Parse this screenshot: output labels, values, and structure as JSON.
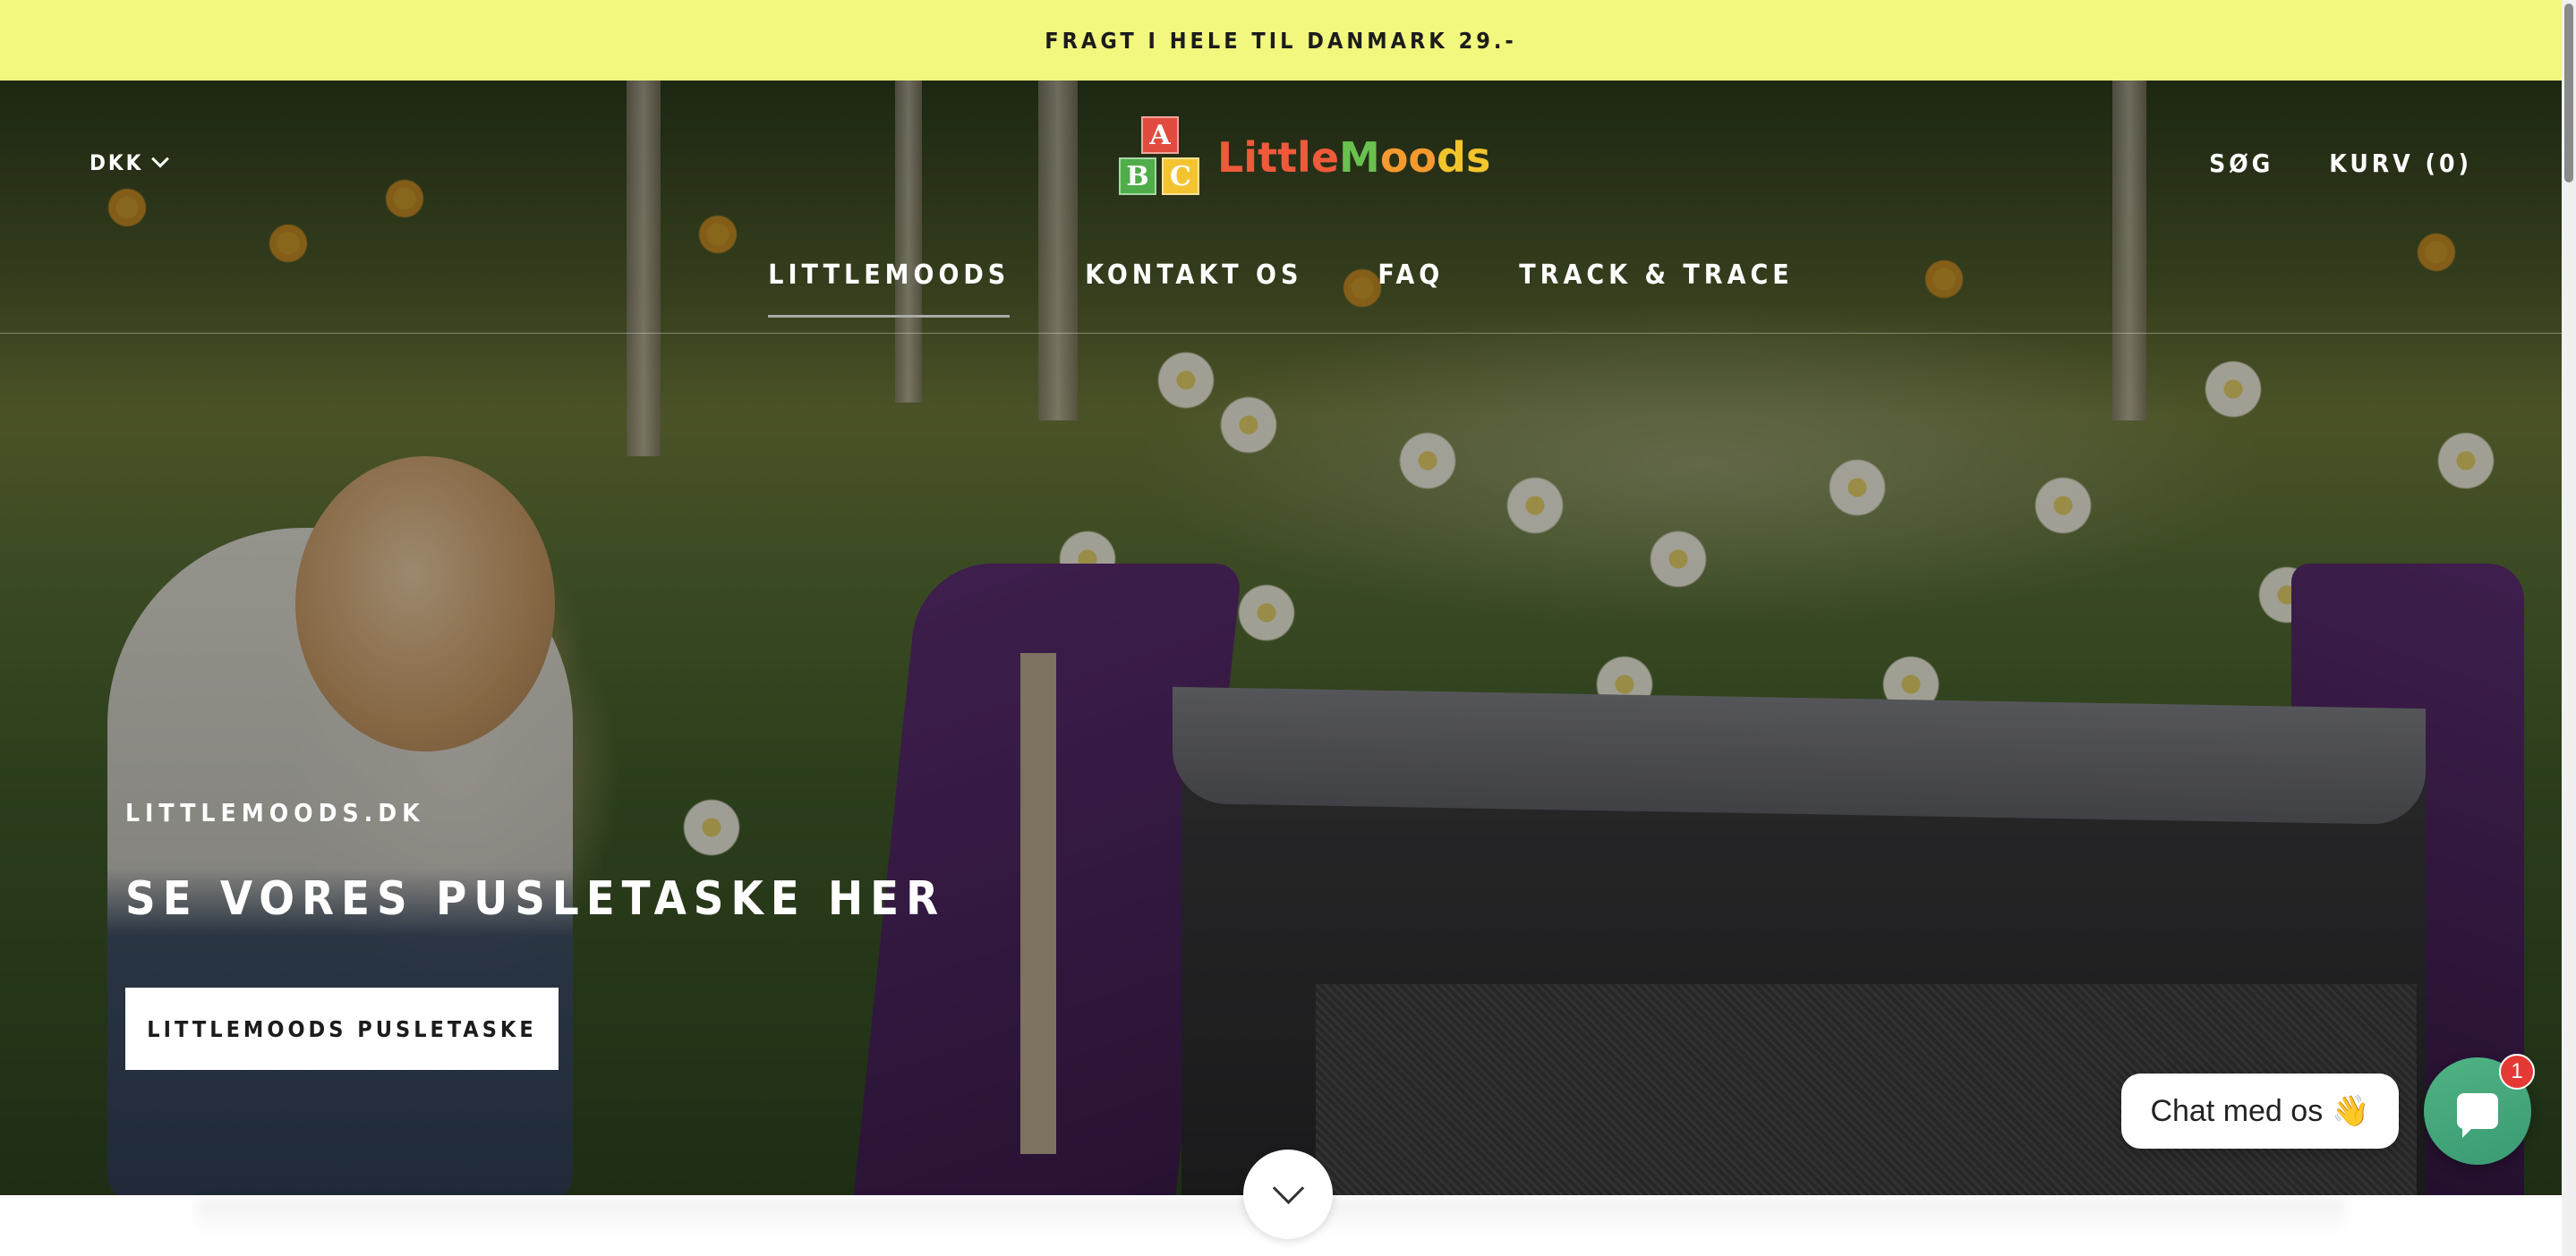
{
  "announcement": {
    "text": "FRAGT I HELE TIL DANMARK 29.-"
  },
  "header": {
    "currency": "DKK",
    "logo": {
      "blocks": [
        "A",
        "B",
        "C"
      ],
      "text_parts": [
        "Little",
        "M",
        "oo",
        "ds"
      ]
    },
    "search_label": "SØG",
    "cart_label": "KURV (0)"
  },
  "nav": {
    "items": [
      {
        "label": "LITTLEMOODS",
        "active": true
      },
      {
        "label": "KONTAKT OS",
        "active": false
      },
      {
        "label": "FAQ",
        "active": false
      },
      {
        "label": "TRACK & TRACE",
        "active": false
      }
    ]
  },
  "hero": {
    "eyebrow": "LITTLEMOODS.DK",
    "headline": "SE VORES PUSLETASKE HER",
    "cta_label": "LITTLEMOODS PUSLETASKE"
  },
  "chat": {
    "pill_text": "Chat med os",
    "pill_emoji": "👋",
    "badge_count": "1",
    "icon": "chat-bubble-icon"
  },
  "colors": {
    "announcement_bg": "#f2f77e",
    "chat_button": "#4fb383",
    "badge": "#e53935"
  }
}
